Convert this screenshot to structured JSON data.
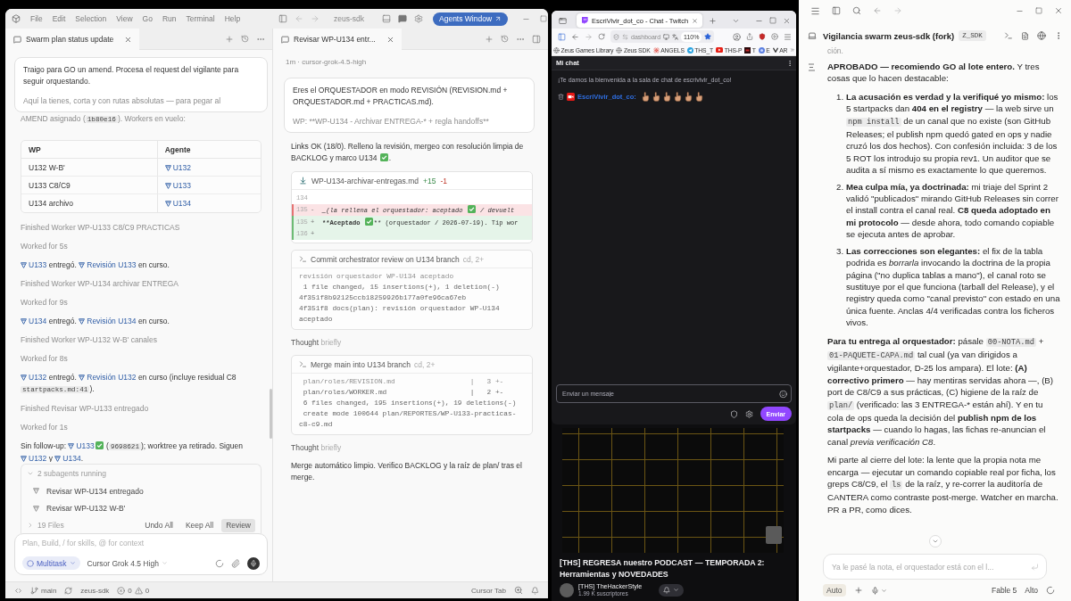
{
  "cursor_window": {
    "menu": [
      "File",
      "Edit",
      "Selection",
      "View",
      "Go",
      "Run",
      "Terminal",
      "Help"
    ],
    "project": "zeus-sdk",
    "agents_button": "Agents Window",
    "left_pane": {
      "tab": {
        "title": "Swarm plan status update",
        "selected": true
      },
      "thread": [
        {
          "kind": "user_message",
          "text": "Traigo para GO un amend. Procesa el request del vigilante para seguir orquestando.",
          "faded_text": "Aquí la tienes, corta y con rutas absolutas — para pegar al"
        },
        {
          "kind": "note",
          "parts": [
            {
              "kind": "text",
              "text": "AMEND asignado ("
            },
            {
              "kind": "code",
              "text": "1b80e16"
            },
            {
              "kind": "text",
              "text": "). Workers en vuelo:"
            }
          ]
        },
        {
          "kind": "table",
          "columns": [
            "WP",
            "Agente"
          ],
          "rows": [
            {
              "wp": "U132 W-B'",
              "agent": "U132"
            },
            {
              "wp": "U133 C8/C9",
              "agent": "U133"
            },
            {
              "wp": "U134 archivo",
              "agent": "U134"
            }
          ]
        },
        {
          "kind": "status",
          "text": "Finished Worker WP-U133 C8/C9 PRACTICAS"
        },
        {
          "kind": "status",
          "text": "Worked for 5s"
        },
        {
          "kind": "message",
          "parts": [
            {
              "kind": "link",
              "text": "U133"
            },
            {
              "kind": "text",
              "text": " entregó. "
            },
            {
              "kind": "link",
              "text": "Revisión U133"
            },
            {
              "kind": "text",
              "text": " en curso."
            }
          ]
        },
        {
          "kind": "status",
          "text": "Finished Worker WP-U134 archivar ENTREGA"
        },
        {
          "kind": "status",
          "text": "Worked for 9s"
        },
        {
          "kind": "message",
          "parts": [
            {
              "kind": "link",
              "text": "U134"
            },
            {
              "kind": "text",
              "text": " entregó. "
            },
            {
              "kind": "link",
              "text": "Revisión U134"
            },
            {
              "kind": "text",
              "text": " en curso."
            }
          ]
        },
        {
          "kind": "status",
          "text": "Finished Worker WP-U132 W-B' canales"
        },
        {
          "kind": "status",
          "text": "Worked for 8s"
        },
        {
          "kind": "message",
          "parts": [
            {
              "kind": "link",
              "text": "U132"
            },
            {
              "kind": "text",
              "text": " entregó. "
            },
            {
              "kind": "link",
              "text": "Revisión U132"
            },
            {
              "kind": "text",
              "text": " en curso (incluye residual C8 "
            },
            {
              "kind": "code",
              "text": "startpacks.md:41"
            },
            {
              "kind": "text",
              "text": ")."
            }
          ]
        },
        {
          "kind": "status",
          "text": "Finished Revisar WP-U133 entregado"
        },
        {
          "kind": "status",
          "text": "Worked for 1s"
        },
        {
          "kind": "message",
          "parts": [
            {
              "kind": "text",
              "text": "Sin follow-up: "
            },
            {
              "kind": "link",
              "text": "U133"
            },
            {
              "kind": "check"
            },
            {
              "kind": "text",
              "text": " ("
            },
            {
              "kind": "code",
              "text": "9698621"
            },
            {
              "kind": "text",
              "text": "); worktree ya retirado. Siguen "
            },
            {
              "kind": "link",
              "text": "U132"
            },
            {
              "kind": "text",
              "text": " y "
            },
            {
              "kind": "link",
              "text": "U134"
            },
            {
              "kind": "text",
              "text": "."
            }
          ]
        }
      ],
      "subagents": {
        "summary": "2 subagents running",
        "expanded": true,
        "items": [
          "Revisar WP-U134 entregado",
          "Revisar WP-U132 W-B'"
        ]
      },
      "files": {
        "label": "19 Files",
        "expanded": false
      },
      "file_actions": [
        {
          "label": "Undo All",
          "kind": "plain"
        },
        {
          "label": "Keep All",
          "kind": "plain"
        },
        {
          "label": "Review",
          "kind": "filled"
        }
      ],
      "composer": {
        "placeholder": "Plan, Build, / for skills, @ for context",
        "mode": "Multitask",
        "model": "Cursor Grok 4.5 High"
      }
    },
    "right_pane": {
      "tab": {
        "title": "Revisar WP-U134 entr...",
        "selected": true
      },
      "thread": [
        {
          "kind": "meta",
          "text": "1m · cursor-grok-4.5-high"
        },
        {
          "kind": "user_message",
          "text": "Eres el ORQUESTADOR en modo REVISIÓN (REVISION.md + ORQUESTADOR.md + PRACTICAS.md).",
          "faded_text": "WP: **WP-U134 - Archivar ENTREGA-* + regla handoffs**"
        },
        {
          "kind": "message",
          "parts": [
            {
              "kind": "text",
              "text": "Links OK (18/0). Relleno la revisión, mergeo con resolución limpia de BACKLOG y marco U134 "
            },
            {
              "kind": "check"
            },
            {
              "kind": "text",
              "text": "."
            }
          ]
        },
        {
          "kind": "diff",
          "file": "WP-U134-archivar-entregas.md",
          "added": "+15",
          "removed": "-1",
          "lines": [
            {
              "number": "134",
              "kind": "context"
            },
            {
              "number": "135",
              "kind": "removed",
              "sign": "-",
              "parts": [
                {
                  "kind": "italic",
                  "text": "_(la rellena el orquestador: aceptado "
                },
                {
                  "kind": "check"
                },
                {
                  "kind": "italic",
                  "text": " / devuelt"
                }
              ]
            },
            {
              "number": "135",
              "kind": "added",
              "sign": "+",
              "parts": [
                {
                  "kind": "bold",
                  "text": "**Aceptado "
                },
                {
                  "kind": "check"
                },
                {
                  "kind": "text",
                  "text": "** (orquestador / 2026-07-19). Tip wor"
                }
              ]
            },
            {
              "number": "136",
              "kind": "added",
              "sign": "+"
            }
          ]
        },
        {
          "kind": "command",
          "title": "Commit orchestrator review on U134 branch",
          "meta": "cd, 2+",
          "faded_line": "revisión orquestador WP-U134 aceptado",
          "lines": [
            " 1 file changed, 15 insertions(+), 1 deletion(-)",
            "4f351f8b92125ccb18259926b177a0fe96ca67eb",
            "4f351f8 docs(plan): revisión orquestador WP-U134 aceptado"
          ]
        },
        {
          "kind": "thought",
          "text": "Thought",
          "detail": "briefly"
        },
        {
          "kind": "command",
          "title": "Merge main into U134 branch",
          "meta": "cd, 2+",
          "faded_line": " plan/roles/REVISION.md                  |   3 +-",
          "lines": [
            " plan/roles/WORKER.md                    |   2 +-",
            " 6 files changed, 195 insertions(+), 19 deletions(-)",
            " create mode 100644 plan/REPORTES/WP-U133-practicas-c8-c9.md"
          ]
        },
        {
          "kind": "thought",
          "text": "Thought",
          "detail": "briefly"
        },
        {
          "kind": "message",
          "parts": [
            {
              "kind": "text",
              "text": "Merge automático limpio. Verifico BACKLOG y la raíz de plan/ tras el merge."
            }
          ]
        }
      ]
    },
    "status_bar": {
      "branch": "main",
      "project": "zeus-sdk",
      "errors": "0",
      "warnings": "0",
      "right_item": "Cursor Tab"
    }
  },
  "browser": {
    "tab": {
      "title": "EscriVivir_dot_co - Chat - Twitch",
      "selected": true
    },
    "address": "dashboard",
    "zoom": "110%",
    "bookmarked": true,
    "bookmarks": [
      {
        "label": "Zeus Games Library",
        "kind": "globe"
      },
      {
        "label": "Zeus SDK",
        "kind": "globe"
      },
      {
        "label": "ANGELS",
        "kind": "flower"
      },
      {
        "label": "THS_T",
        "kind": "send"
      },
      {
        "label": "THS-P",
        "kind": "play"
      },
      {
        "label": "T",
        "kind": "square"
      },
      {
        "label": "E",
        "kind": "circle"
      },
      {
        "label": "AR",
        "kind": "chevron"
      }
    ],
    "chat": {
      "title": "Mi chat",
      "welcome": "¡Te damos la bienvenida a la sala de chat de escrivivir_dot_co!",
      "messages": [
        {
          "user": "EscriVivir_dot_co:",
          "color": "#2f6fe4",
          "emotes": [
            {
              "kind": "hand"
            },
            {
              "kind": "hand"
            },
            {
              "kind": "hand"
            },
            {
              "kind": "hand"
            },
            {
              "kind": "hand"
            },
            {
              "kind": "hand"
            }
          ]
        }
      ],
      "input_placeholder": "Enviar un mensaje",
      "send_button": "Enviar"
    },
    "video": {
      "title": "[THS] REGRESA nuestro PODCAST — TEMPORADA 2: Herramientas y NOVEDADES",
      "channel": "[THS] TheHackerStyle",
      "subscribers": "1.99 K suscriptores"
    }
  },
  "assistant_window": {
    "title": "Vigilancia swarm zeus-sdk (fork)",
    "badge": "Z_SDK",
    "cut_text": "ción.",
    "blocks": [
      {
        "kind": "paragraph",
        "parts": [
          {
            "kind": "bold",
            "text": "APROBADO — recomiendo GO al lote entero."
          },
          {
            "kind": "text",
            "text": " Y tres cosas que lo hacen destacable:"
          }
        ]
      },
      {
        "kind": "list",
        "items": [
          {
            "number": "1.",
            "parts": [
              {
                "kind": "bold",
                "text": "La acusación es verdad y la verifiqué yo mismo:"
              },
              {
                "kind": "text",
                "text": " los 5 startpacks dan "
              },
              {
                "kind": "bold",
                "text": "404 en el registry"
              },
              {
                "kind": "text",
                "text": " — la web sirve un "
              },
              {
                "kind": "code",
                "text": "npm install"
              },
              {
                "kind": "text",
                "text": " de un canal que no existe (son GitHub Releases; el publish npm quedó gated en ops y nadie cruzó los dos hechos). Con confesión incluida: 3 de los 5 ROT los introdujo su propia rev1. Un auditor que se audita a sí mismo es exactamente lo que queremos."
              }
            ]
          },
          {
            "number": "2.",
            "parts": [
              {
                "kind": "bold",
                "text": "Mea culpa mía, ya doctrinada:"
              },
              {
                "kind": "text",
                "text": " mi triaje del Sprint 2 validó \"publicados\" mirando GitHub Releases sin correr el install contra el canal real. "
              },
              {
                "kind": "bold",
                "text": "C8 queda adoptado en mi protocolo"
              },
              {
                "kind": "text",
                "text": " — desde ahora, todo comando copiable se ejecuta antes de aprobar."
              }
            ]
          },
          {
            "number": "3.",
            "parts": [
              {
                "kind": "bold",
                "text": "Las correcciones son elegantes:"
              },
              {
                "kind": "text",
                "text": " el fix de la tabla podrida es "
              },
              {
                "kind": "italic",
                "text": "borrarla"
              },
              {
                "kind": "text",
                "text": " invocando la doctrina de la propia página (\"no duplica tablas a mano\"), el canal roto se sustituye por el que funciona (tarball del Release), y el registry queda como \"canal previsto\" con estado en una única fuente. Anclas 4/4 verificadas contra los ficheros vivos."
              }
            ]
          }
        ]
      },
      {
        "kind": "paragraph",
        "parts": [
          {
            "kind": "bold",
            "text": "Para tu entrega al orquestador:"
          },
          {
            "kind": "text",
            "text": " pásale "
          },
          {
            "kind": "code",
            "text": "00-NOTA.md"
          },
          {
            "kind": "text",
            "text": " + "
          },
          {
            "kind": "code",
            "text": "01-PAQUETE-CAPA.md"
          },
          {
            "kind": "text",
            "text": " tal cual (ya van dirigidos a vigilante+orquestador, D-25 los ampara). El lote: "
          },
          {
            "kind": "bold",
            "text": "(A) correctivo primero"
          },
          {
            "kind": "text",
            "text": " — hay mentiras servidas ahora —, (B) port de C8/C9 a sus prácticas, (C) higiene de la raíz de "
          },
          {
            "kind": "code",
            "text": "plan/"
          },
          {
            "kind": "text",
            "text": " (verificado: las 3 ENTREGA-* están ahí). Y en tu cola de ops queda la decisión del "
          },
          {
            "kind": "bold",
            "text": "publish npm de los startpacks"
          },
          {
            "kind": "text",
            "text": " — cuando lo hagas, las fichas re-anuncian el canal "
          },
          {
            "kind": "italic",
            "text": "previa verificación C8"
          },
          {
            "kind": "text",
            "text": "."
          }
        ]
      },
      {
        "kind": "paragraph",
        "parts": [
          {
            "kind": "text",
            "text": "Mi parte al cierre del lote: la lente que la propia nota me encarga — ejecutar un comando copiable real por ficha, los greps C8/C9, el "
          },
          {
            "kind": "code",
            "text": "ls"
          },
          {
            "kind": "text",
            "text": " de la raíz, y re-correr la auditoría de CANTERA como contraste post-merge. Watcher en marcha. PR a PR, como dices."
          }
        ]
      }
    ],
    "input_placeholder": "Ya le pasé la nota, el orquestador está con el l...",
    "mode": "Auto",
    "model": "Fable 5",
    "effort": "Alto"
  }
}
